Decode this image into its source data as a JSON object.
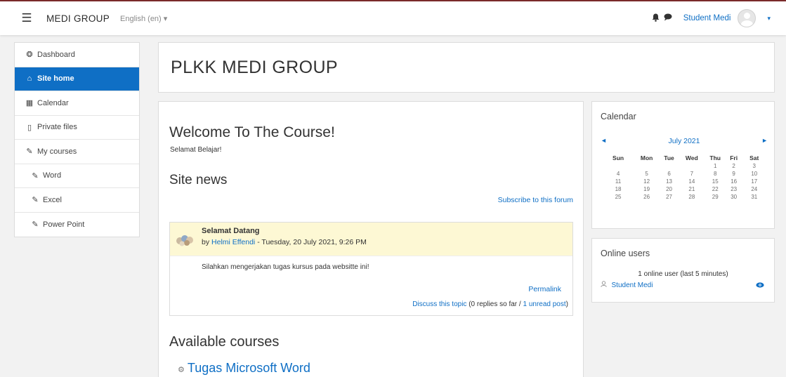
{
  "navbar": {
    "menu_icon": "hamburger-menu-icon",
    "brand": "MEDI GROUP",
    "language": "English (en) ▾",
    "notification_icon": "bell-icon",
    "messages_icon": "speech-bubble-icon",
    "user_name": "Student Medi",
    "user_menu_caret": "▾"
  },
  "drawer": {
    "items": [
      {
        "label": "Dashboard",
        "icon": "dashboard-icon",
        "glyph": "❂",
        "active": false
      },
      {
        "label": "Site home",
        "icon": "home-icon",
        "glyph": "⌂",
        "active": true
      },
      {
        "label": "Calendar",
        "icon": "calendar-icon",
        "glyph": "▦",
        "active": false
      },
      {
        "label": "Private files",
        "icon": "file-icon",
        "glyph": "▯",
        "active": false
      },
      {
        "label": "My courses",
        "icon": "graduation-cap-icon",
        "glyph": "✎",
        "active": false
      },
      {
        "label": "Word",
        "icon": "graduation-cap-icon",
        "glyph": "✎",
        "active": false
      },
      {
        "label": "Excel",
        "icon": "graduation-cap-icon",
        "glyph": "✎",
        "active": false
      },
      {
        "label": "Power Point",
        "icon": "graduation-cap-icon",
        "glyph": "✎",
        "active": false
      }
    ]
  },
  "header": {
    "title": "PLKK MEDI GROUP"
  },
  "main": {
    "welcome_title": "Welcome To The Course!",
    "welcome_sub": "Selamat Belajar!",
    "news_title": "Site news",
    "subscribe": "Subscribe to this forum",
    "post": {
      "title": "Selamat Datang",
      "by_prefix": "by",
      "author": "Helmi Effendi",
      "date": "- Tuesday, 20 July 2021, 9:26 PM",
      "body": "Silahkan mengerjakan tugas kursus pada websitte ini!",
      "permalink": "Permalink",
      "discuss": "Discuss this topic",
      "replies": "(0 replies so far /",
      "unread": "1 unread post",
      "close_paren": ")"
    },
    "available_title": "Available courses",
    "course": "Tugas Microsoft Word"
  },
  "calendar": {
    "title": "Calendar",
    "month": "July 2021",
    "prev": "◄",
    "next": "►",
    "weekdays": [
      "Sun",
      "Mon",
      "Tue",
      "Wed",
      "Thu",
      "Fri",
      "Sat"
    ],
    "weeks": [
      [
        "",
        "",
        "",
        "",
        "1",
        "2",
        "3"
      ],
      [
        "4",
        "5",
        "6",
        "7",
        "8",
        "9",
        "10"
      ],
      [
        "11",
        "12",
        "13",
        "14",
        "15",
        "16",
        "17"
      ],
      [
        "18",
        "19",
        "20",
        "21",
        "22",
        "23",
        "24"
      ],
      [
        "25",
        "26",
        "27",
        "28",
        "29",
        "30",
        "31"
      ]
    ]
  },
  "online": {
    "title": "Online users",
    "count": "1 online user (last 5 minutes)",
    "user": "Student Medi"
  },
  "colors": {
    "accent": "#0f6fc5",
    "post_header_bg": "#fdf8d4",
    "navbar_top_border": "#7a2a2a"
  }
}
